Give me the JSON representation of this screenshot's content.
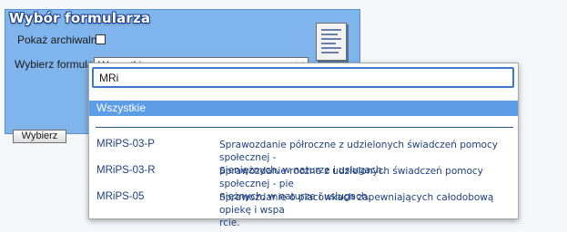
{
  "panel": {
    "title": "Wybór formularza",
    "archived_label": "Pokaż archiwalne:",
    "form_label": "Wybierz formularz:",
    "selected_form": "Wszystkie",
    "choose_button": "Wybierz"
  },
  "dropdown": {
    "search_value": "MRi",
    "selected_option": "Wszystkie",
    "options": [
      {
        "code": "MRiPS-03-P",
        "desc_line1": "Sprawozdanie półroczne z udzielonych świadczeń pomocy społecznej -",
        "desc_line2": "pieniężnych, w naturze i usługach."
      },
      {
        "code": "MRiPS-03-R",
        "desc_line1": "Sprawozdanie roczne z udzielonych świadczeń pomocy społecznej - pie",
        "desc_line2": "niężnych, w naturze i usługach."
      },
      {
        "code": "MRiPS-05",
        "desc_line1": "Sprawozdanie o placówkach zapewniających całodobową opiekę i wspa",
        "desc_line2": "rcie."
      }
    ]
  },
  "colors": {
    "panel_bg": "#7fb5ec",
    "selection": "#5c9de6",
    "search_border": "#3a78d1",
    "row_text": "#1d3f7f"
  },
  "icons": [
    "form-document-icon",
    "chevron-down-icon"
  ]
}
